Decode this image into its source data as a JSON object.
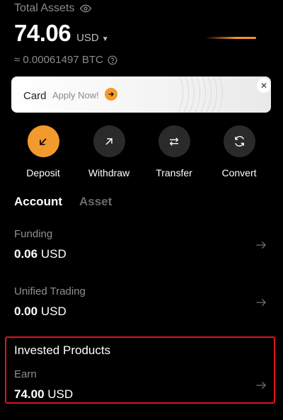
{
  "header": {
    "total_label": "Total Assets",
    "balance_value": "74.06",
    "balance_currency": "USD",
    "btc_equiv": "≈ 0.00061497 BTC"
  },
  "banner": {
    "title": "Card",
    "cta": "Apply Now!"
  },
  "actions": [
    {
      "label": "Deposit",
      "icon": "arrow-down-left-icon"
    },
    {
      "label": "Withdraw",
      "icon": "arrow-up-right-icon"
    },
    {
      "label": "Transfer",
      "icon": "swap-icon"
    },
    {
      "label": "Convert",
      "icon": "refresh-icon"
    }
  ],
  "tabs": [
    {
      "label": "Account",
      "active": true
    },
    {
      "label": "Asset",
      "active": false
    }
  ],
  "accounts": [
    {
      "name": "Funding",
      "amount": "0.06",
      "currency": "USD"
    },
    {
      "name": "Unified Trading",
      "amount": "0.00",
      "currency": "USD"
    }
  ],
  "invested": {
    "title": "Invested Products",
    "name": "Earn",
    "amount": "74.00",
    "currency": "USD"
  },
  "colors": {
    "accent": "#f39a2e",
    "background": "#000000",
    "highlight_border": "#e0141c"
  }
}
